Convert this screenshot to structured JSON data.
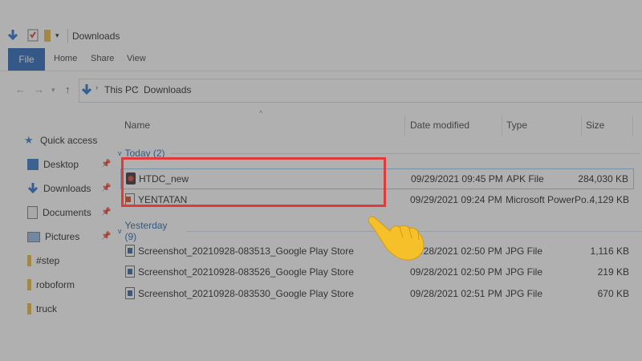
{
  "window": {
    "title": "Downloads"
  },
  "ribbon": {
    "tabs": [
      "File",
      "Home",
      "Share",
      "View"
    ]
  },
  "address": {
    "crumbs": [
      "This PC",
      "Downloads"
    ]
  },
  "sidebar": {
    "items": [
      {
        "label": "Quick access",
        "icon": "star-icon",
        "pinned": false
      },
      {
        "label": "Desktop",
        "icon": "desktop-icon",
        "pinned": true
      },
      {
        "label": "Downloads",
        "icon": "download-arrow-icon",
        "pinned": true
      },
      {
        "label": "Documents",
        "icon": "document-icon",
        "pinned": true
      },
      {
        "label": "Pictures",
        "icon": "pictures-icon",
        "pinned": true
      },
      {
        "label": "#step",
        "icon": "folder-icon",
        "pinned": false
      },
      {
        "label": "roboform",
        "icon": "folder-icon",
        "pinned": false
      },
      {
        "label": "truck",
        "icon": "folder-icon",
        "pinned": false
      }
    ]
  },
  "columns": {
    "name": "Name",
    "date": "Date modified",
    "type": "Type",
    "size": "Size"
  },
  "groups": [
    {
      "label": "Today (2)"
    },
    {
      "label": "Yesterday (9)"
    }
  ],
  "files": [
    {
      "name": "HTDC_new",
      "date": "09/29/2021 09:45 PM",
      "type": "APK File",
      "size": "284,030 KB",
      "icon": "apk-icon"
    },
    {
      "name": "YENTATAN",
      "date": "09/29/2021 09:24 PM",
      "type": "Microsoft PowerPo...",
      "size": "4,129 KB",
      "icon": "powerpoint-icon"
    },
    {
      "name": "Screenshot_20210928-083513_Google Play Store",
      "date": "09/28/2021 02:50 PM",
      "type": "JPG File",
      "size": "1,116 KB",
      "icon": "image-file-icon"
    },
    {
      "name": "Screenshot_20210928-083526_Google Play Store",
      "date": "09/28/2021 02:50 PM",
      "type": "JPG File",
      "size": "219 KB",
      "icon": "image-file-icon"
    },
    {
      "name": "Screenshot_20210928-083530_Google Play Store",
      "date": "09/28/2021 02:51 PM",
      "type": "JPG File",
      "size": "670 KB",
      "icon": "image-file-icon"
    }
  ],
  "colors": {
    "accent": "#1e5fb4",
    "highlight": "#e03a3a",
    "group": "#1c5fa8",
    "pointer": "#f5c02a"
  }
}
